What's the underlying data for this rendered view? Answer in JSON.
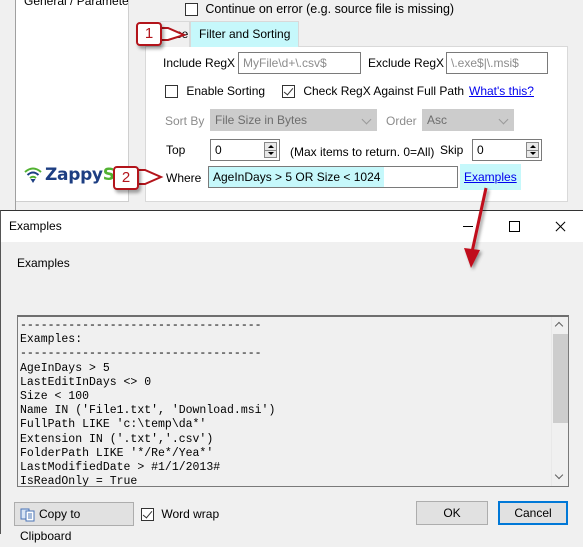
{
  "parent_window": {
    "nav_item": "General / Paramete",
    "logo": {
      "text_blue": "Zappy",
      "text_green": "Sy",
      "icon": "wifi-signal-icon"
    },
    "continue_on_error": {
      "label": "Continue on error (e.g. source file is missing)",
      "checked": false
    },
    "tabs": [
      {
        "label": "urce",
        "active": false
      },
      {
        "label": "Filter and Sorting",
        "active": true
      }
    ],
    "filter": {
      "include_label": "Include RegX",
      "include_placeholder": "MyFile\\d+\\.csv$",
      "exclude_label": "Exclude RegX",
      "exclude_placeholder": "\\.exe$|\\.msi$",
      "enable_sorting": {
        "label": "Enable Sorting",
        "checked": false
      },
      "check_full_path": {
        "label": "Check RegX Against Full Path",
        "checked": true
      },
      "whats_this": "What's this?",
      "sort_by_label": "Sort By",
      "sort_by_value": "File Size in Bytes",
      "order_label": "Order",
      "order_value": "Asc",
      "top_label": "Top",
      "top_value": "0",
      "top_hint": "(Max items to return. 0=All)",
      "skip_label": "Skip",
      "skip_value": "0",
      "where_label": "Where",
      "where_value": "AgeInDays > 5 OR Size < 1024",
      "examples_link": "Examples"
    },
    "callouts": [
      "1",
      "2"
    ],
    "colors": {
      "highlight": "#c6f8fb",
      "callout": "#b3141b",
      "link": "#0000ee"
    }
  },
  "dialog": {
    "title": "Examples",
    "label": "Examples",
    "code_lines": [
      "-----------------------------------",
      "Examples:",
      "-----------------------------------",
      "AgeInDays > 5",
      "LastEditInDays <> 0",
      "Size < 100",
      "Name IN ('File1.txt', 'Download.msi')",
      "FullPath LIKE 'c:\\temp\\da*'",
      "Extension IN ('.txt','.csv')",
      "FolderPath LIKE '*/Re*/Yea*'",
      "LastModifiedDate > #1/1/2013#",
      "IsReadOnly = True"
    ],
    "copy_button": "Copy to Clipboard",
    "word_wrap": {
      "label": "Word wrap",
      "checked": true
    },
    "ok_button": "OK",
    "cancel_button": "Cancel"
  }
}
